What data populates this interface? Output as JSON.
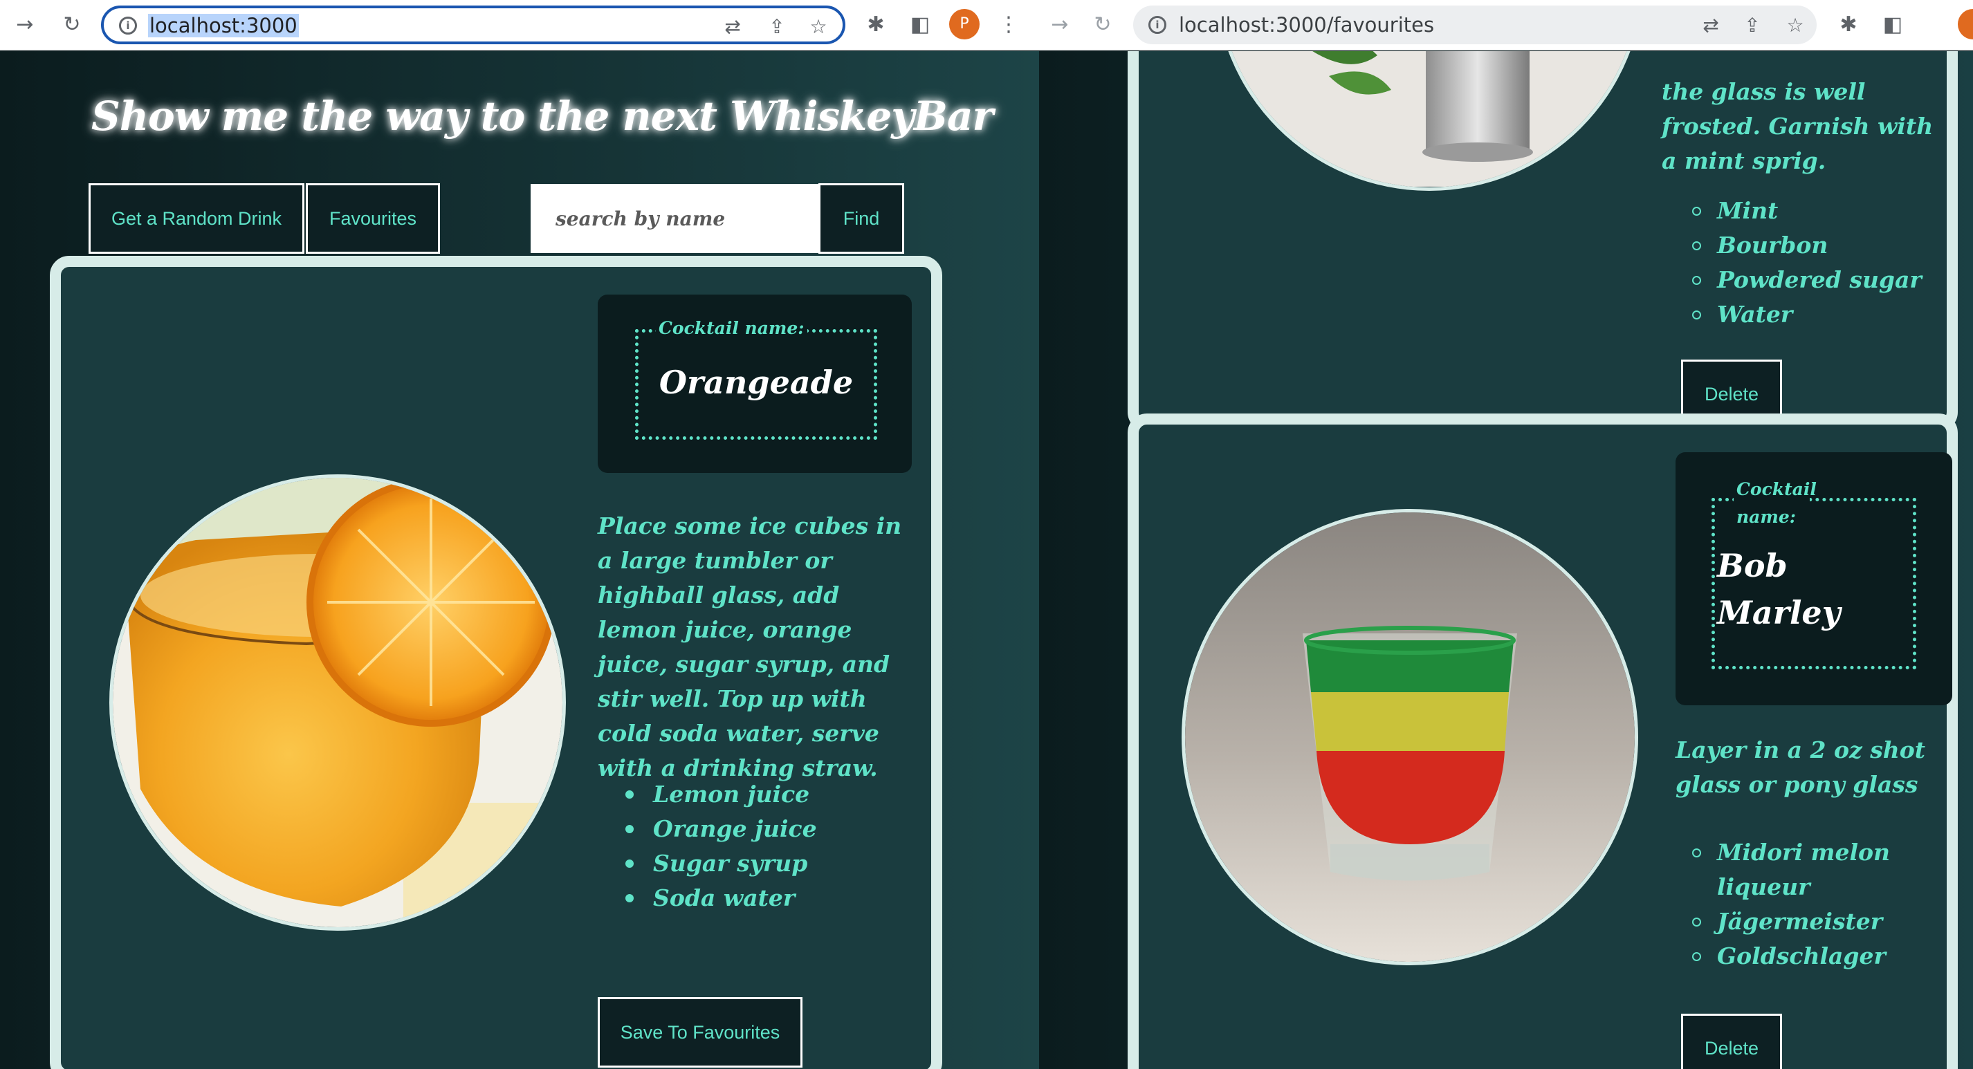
{
  "left_browser": {
    "url": "localhost:3000",
    "avatar_letter": "P"
  },
  "right_browser": {
    "url": "localhost:3000/favourites"
  },
  "site": {
    "title": "Show me the way to the next WhiskeyBar",
    "random_button": "Get a Random Drink",
    "favourites_button": "Favourites",
    "search_placeholder": "search by name",
    "find_button": "Find"
  },
  "random_drink": {
    "name_label": "Cocktail name:",
    "name": "Orangeade",
    "instructions": "Place some ice cubes in a large tumbler or highball glass, add lemon juice, orange juice, sugar syrup, and stir well. Top up with cold soda water, serve with a drinking straw.",
    "ingredients": [
      "Lemon juice",
      "Orange juice",
      "Sugar syrup",
      "Soda water"
    ],
    "save_button": "Save To Favourites"
  },
  "favourites": {
    "card1": {
      "instructions_tail": "the glass is well frosted. Garnish with a mint sprig.",
      "ingredients": [
        "Mint",
        "Bourbon",
        "Powdered sugar",
        "Water"
      ],
      "delete_button": "Delete"
    },
    "card2": {
      "name_label": "Cocktail name:",
      "name": "Bob Marley",
      "instructions": "Layer in a 2 oz shot glass or pony glass",
      "ingredients": [
        "Midori melon liqueur",
        "Jägermeister",
        "Goldschlager"
      ],
      "delete_button": "Delete"
    }
  }
}
